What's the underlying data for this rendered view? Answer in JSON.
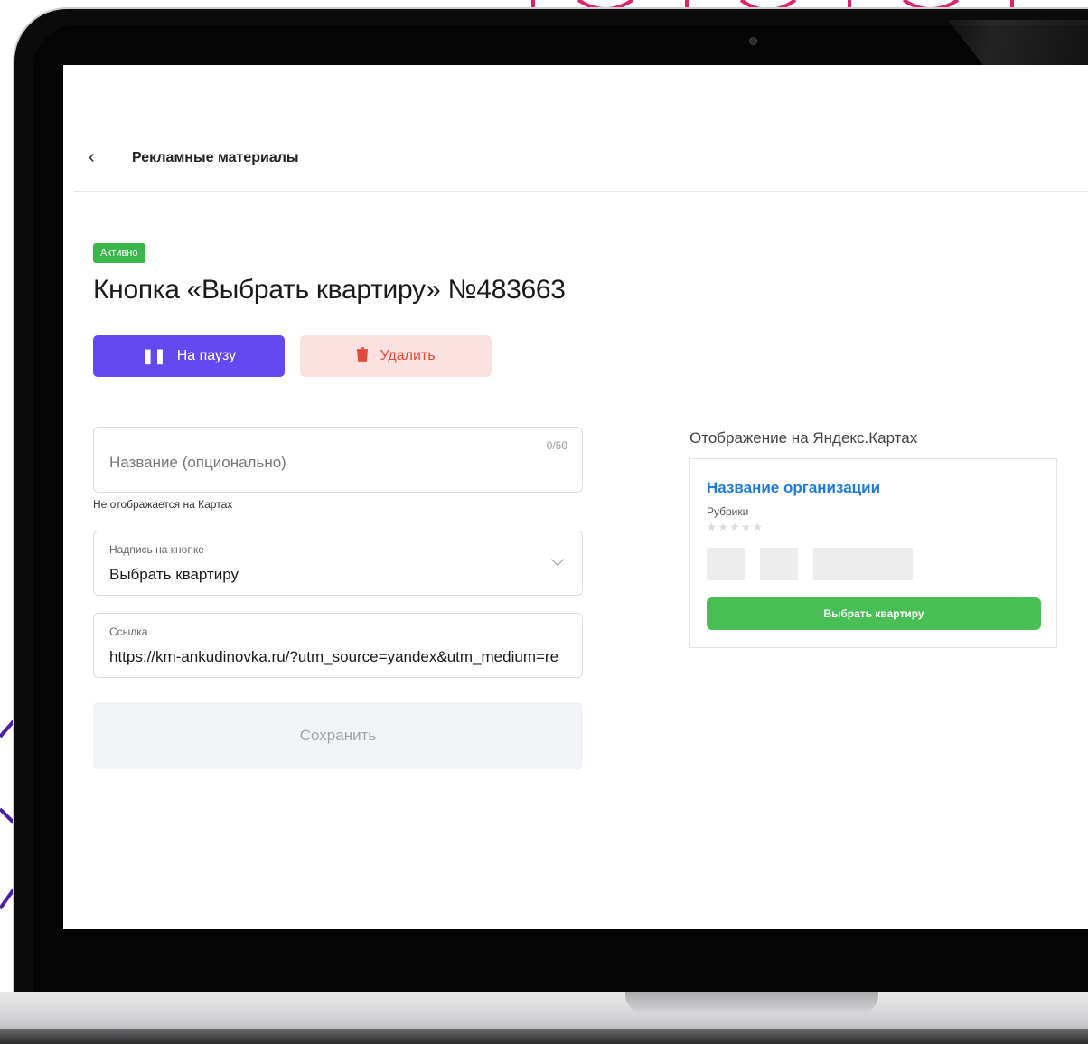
{
  "header": {
    "back_title": "Рекламные материалы"
  },
  "status": "Активно",
  "title": "Кнопка «Выбрать квартиру» №483663",
  "actions": {
    "pause_label": "На паузу",
    "delete_label": "Удалить"
  },
  "form": {
    "name": {
      "placeholder": "Название (опционально)",
      "counter": "0/50",
      "hint": "Не отображается на Картах"
    },
    "button_label": {
      "label": "Надпись на кнопке",
      "value": "Выбрать квартиру"
    },
    "link": {
      "label": "Ссылка",
      "value": "https://km-ankudinovka.ru/?utm_source=yandex&utm_medium=re"
    },
    "save_label": "Сохранить"
  },
  "preview": {
    "title": "Отображение на Яндекс.Картах",
    "org_name": "Название организации",
    "rubric": "Рубрики",
    "button_label": "Выбрать квартиру"
  },
  "colors": {
    "primary": "#6448f0",
    "danger": "#e24b3b",
    "success": "#3bb64b",
    "link": "#1d7bd8"
  }
}
